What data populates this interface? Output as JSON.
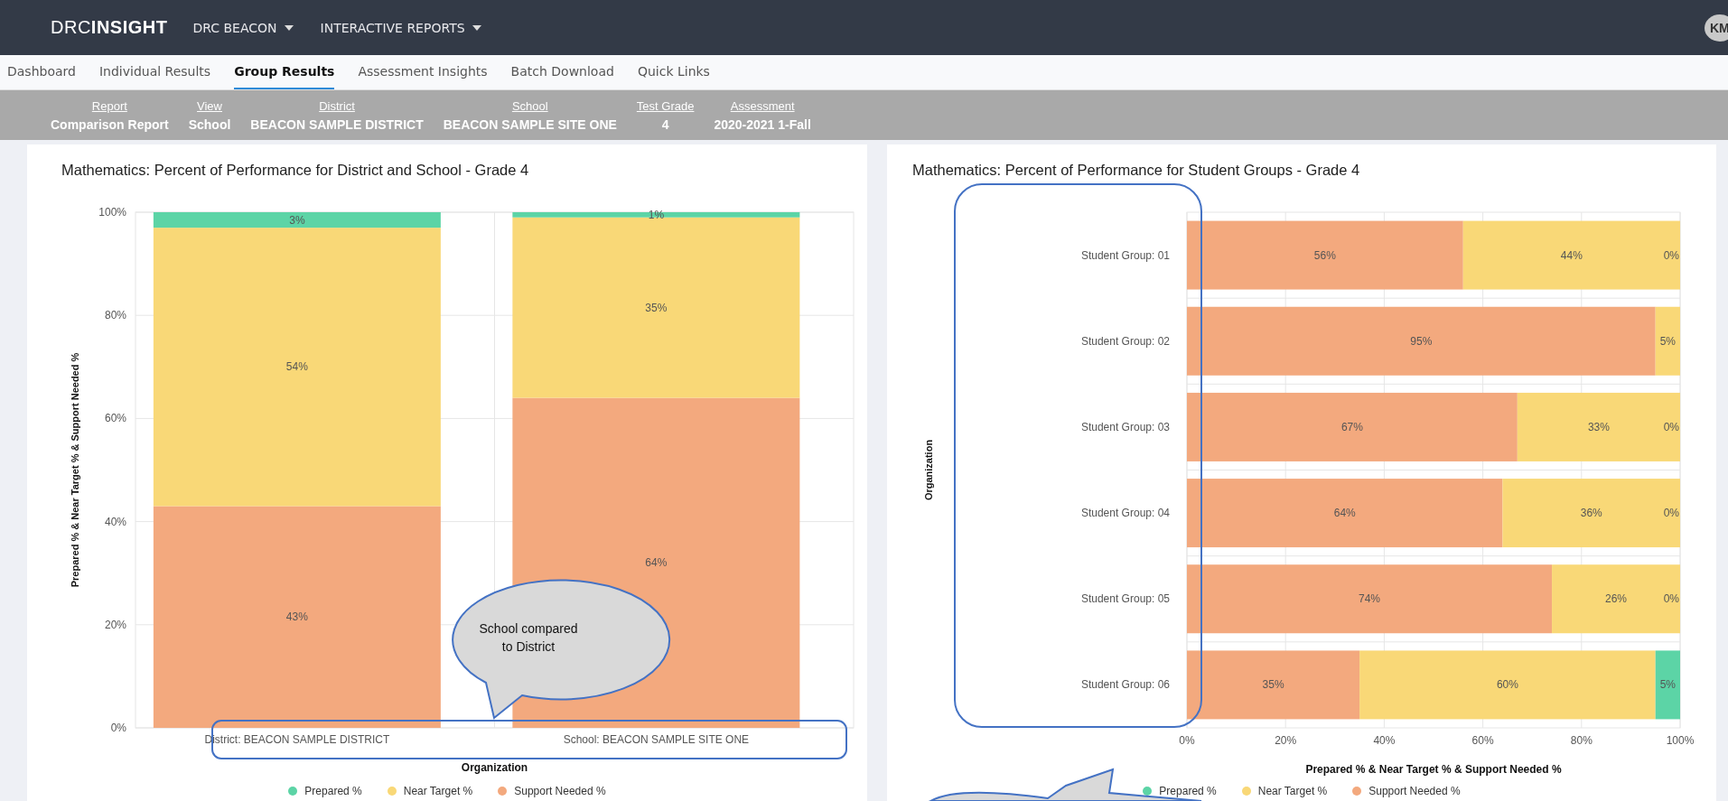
{
  "header": {
    "logo": {
      "light": "DRC",
      "bold": "INSIGHT"
    },
    "menus": [
      {
        "label": "DRC BEACON"
      },
      {
        "label": "INTERACTIVE REPORTS"
      }
    ],
    "avatar": "KM"
  },
  "tabs": [
    {
      "label": "Dashboard",
      "selected": false
    },
    {
      "label": "Individual Results",
      "selected": false
    },
    {
      "label": "Group Results",
      "selected": true
    },
    {
      "label": "Assessment Insights",
      "selected": false
    },
    {
      "label": "Batch Download",
      "selected": false
    },
    {
      "label": "Quick Links",
      "selected": false
    }
  ],
  "info_bar": [
    {
      "label": "Report",
      "value": "Comparison Report"
    },
    {
      "label": "View",
      "value": "School"
    },
    {
      "label": "District",
      "value": "BEACON SAMPLE DISTRICT"
    },
    {
      "label": "School",
      "value": "BEACON SAMPLE SITE ONE"
    },
    {
      "label": "Test Grade",
      "value": "4"
    },
    {
      "label": "Assessment",
      "value": "2020-2021 1-Fall"
    }
  ],
  "panels": [
    {
      "title": "Mathematics: Percent of Performance for District and School - Grade 4",
      "chart_data": {
        "type": "bar",
        "orientation": "vertical",
        "stacked": true,
        "legend": true,
        "grid": true,
        "xlabel": "Organization",
        "ylabel": "Prepared % & Near Target % & Support Needed %",
        "categories": [
          "District: BEACON SAMPLE DISTRICT",
          "School: BEACON SAMPLE SITE ONE"
        ],
        "ylim": [
          0,
          100
        ],
        "yticks": [
          {
            "value": 0,
            "label": "0%"
          },
          {
            "value": 20,
            "label": "20%"
          },
          {
            "value": 40,
            "label": "40%"
          },
          {
            "value": 60,
            "label": "60%"
          },
          {
            "value": 80,
            "label": "80%"
          },
          {
            "value": 100,
            "label": "100%"
          }
        ],
        "series": [
          {
            "name": "Support Needed %",
            "color": "#f3a97e",
            "values": [
              43,
              64
            ],
            "value_labels": [
              "43%",
              "64%"
            ]
          },
          {
            "name": "Near Target %",
            "color": "#f9d877",
            "values": [
              54,
              35
            ],
            "value_labels": [
              "54%",
              "35%"
            ]
          },
          {
            "name": "Prepared %",
            "color": "#5cd4a6",
            "values": [
              3,
              1
            ],
            "value_labels": [
              "3%",
              "1%"
            ]
          }
        ]
      }
    },
    {
      "title": "Mathematics: Percent of Performance for Student Groups - Grade 4",
      "chart_data": {
        "type": "bar",
        "orientation": "horizontal",
        "stacked": true,
        "legend": true,
        "grid": true,
        "xlabel": "Prepared % & Near Target % & Support Needed %",
        "ylabel": "Organization",
        "categories": [
          "Student Group: 01",
          "Student Group: 02",
          "Student Group: 03",
          "Student Group: 04",
          "Student Group: 05",
          "Student Group: 06"
        ],
        "xlim": [
          0,
          100
        ],
        "xticks": [
          {
            "value": 0,
            "label": "0%"
          },
          {
            "value": 20,
            "label": "20%"
          },
          {
            "value": 40,
            "label": "40%"
          },
          {
            "value": 60,
            "label": "60%"
          },
          {
            "value": 80,
            "label": "80%"
          },
          {
            "value": 100,
            "label": "100%"
          }
        ],
        "series": [
          {
            "name": "Support Needed %",
            "color": "#f3a97e",
            "values": [
              56,
              95,
              67,
              64,
              74,
              35
            ],
            "value_labels": [
              "56%",
              "95%",
              "67%",
              "64%",
              "74%",
              "35%"
            ]
          },
          {
            "name": "Near Target %",
            "color": "#f9d877",
            "values": [
              44,
              5,
              33,
              36,
              26,
              60
            ],
            "value_labels": [
              "44%",
              "5%",
              "33%",
              "36%",
              "26%",
              "60%"
            ]
          },
          {
            "name": "Prepared %",
            "color": "#5cd4a6",
            "values": [
              0,
              null,
              0,
              0,
              0,
              5
            ],
            "value_labels": [
              "0%",
              null,
              "0%",
              "0%",
              "0%",
              "5%"
            ]
          }
        ]
      }
    }
  ],
  "callout": {
    "text": "School compared to District"
  }
}
